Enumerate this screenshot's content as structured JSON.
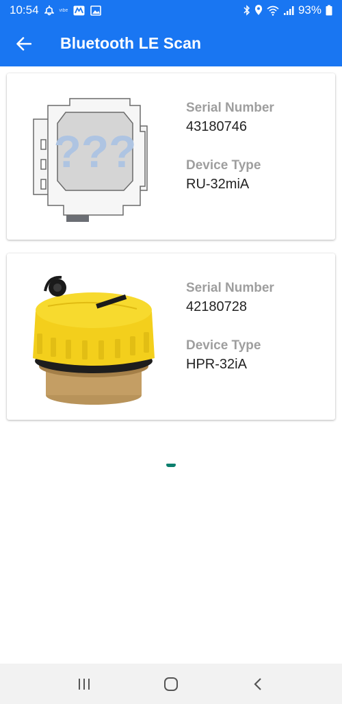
{
  "status_bar": {
    "time": "10:54",
    "battery_percent": "93%",
    "left_icons": [
      "notification-icon",
      "vibe-icon",
      "app-icon",
      "gallery-icon"
    ],
    "right_icons": [
      "bluetooth-icon",
      "location-icon",
      "wifi-icon",
      "signal-icon",
      "battery-icon"
    ]
  },
  "app_bar": {
    "title": "Bluetooth LE Scan",
    "back_icon": "arrow-left-icon"
  },
  "devices": [
    {
      "serial_label": "Serial Number",
      "serial_value": "43180746",
      "type_label": "Device Type",
      "type_value": "RU-32miA",
      "image_text": "???",
      "image": "unknown-device-image"
    },
    {
      "serial_label": "Serial Number",
      "serial_value": "42180728",
      "type_label": "Device Type",
      "type_value": "HPR-32iA",
      "image": "yellow-meter-device-image"
    }
  ],
  "loading": {
    "icon": "loading-spinner"
  },
  "nav_bar": {
    "buttons": [
      "recents-icon",
      "home-icon",
      "back-icon"
    ]
  },
  "colors": {
    "primary": "#1976f2",
    "label": "#9e9e9e",
    "spinner": "#0c7f6e",
    "device_yellow": "#f5d21f"
  }
}
